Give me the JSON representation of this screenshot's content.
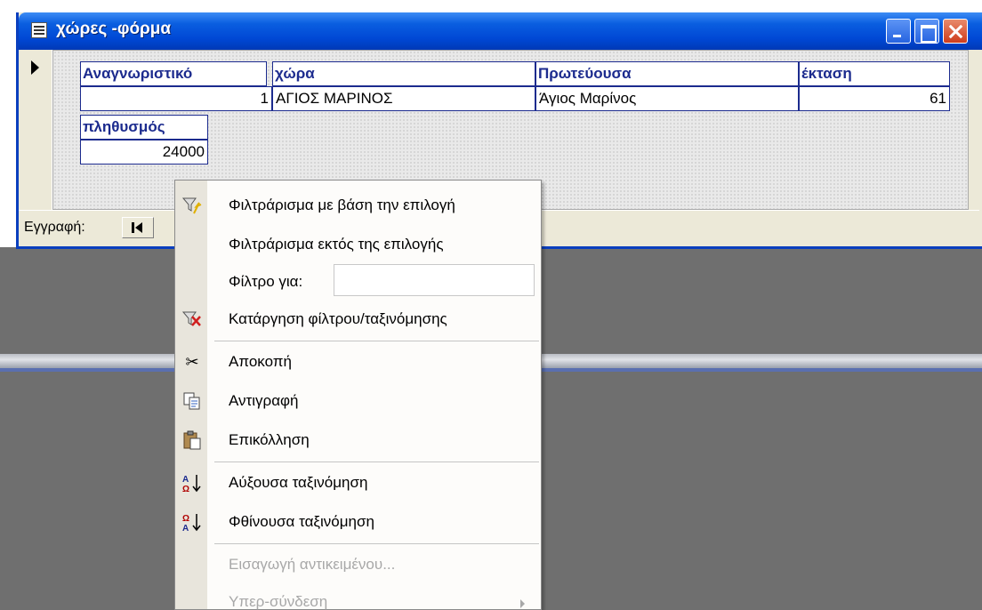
{
  "window": {
    "title": "χώρες -φόρμα"
  },
  "form": {
    "fields": {
      "id": {
        "label": "Αναγνωριστικό",
        "value": "1"
      },
      "country": {
        "label": "χώρα",
        "value": "ΑΓΙΟΣ ΜΑΡΙΝΟΣ"
      },
      "capital": {
        "label": "Πρωτεύουσα",
        "value": "Άγιος Μαρίνος"
      },
      "area": {
        "label": "έκταση",
        "value": "61"
      },
      "population": {
        "label": "πληθυσμός",
        "value": "24000"
      }
    }
  },
  "navigation": {
    "record_label": "Εγγραφή:"
  },
  "context_menu": {
    "items": [
      {
        "label": "Φιλτράρισμα με βάση την επιλογή",
        "icon": "filter-selection-icon",
        "enabled": true
      },
      {
        "label": "Φιλτράρισμα εκτός της επιλογής",
        "icon": "",
        "enabled": true
      },
      {
        "label": "Φίλτρο για:",
        "icon": "",
        "enabled": true,
        "input_value": ""
      },
      {
        "label": "Κατάργηση φίλτρου/ταξινόμησης",
        "icon": "remove-filter-icon",
        "enabled": true
      },
      {
        "label": "Αποκοπή",
        "icon": "scissors-icon",
        "enabled": true
      },
      {
        "label": "Αντιγραφή",
        "icon": "copy-icon",
        "enabled": true
      },
      {
        "label": "Επικόλληση",
        "icon": "paste-icon",
        "enabled": true
      },
      {
        "label": "Αύξουσα ταξινόμηση",
        "icon": "sort-ascending-icon",
        "enabled": true
      },
      {
        "label": "Φθίνουσα ταξινόμηση",
        "icon": "sort-descending-icon",
        "enabled": true
      },
      {
        "label": "Εισαγωγή αντικειμένου...",
        "icon": "",
        "enabled": false
      },
      {
        "label": "Υπερ-σύνδεση",
        "icon": "",
        "enabled": false
      }
    ]
  },
  "colors": {
    "title_bar": "#0048d5",
    "field_label": "#1c2b8e",
    "disabled_text": "#a8a8a8"
  }
}
